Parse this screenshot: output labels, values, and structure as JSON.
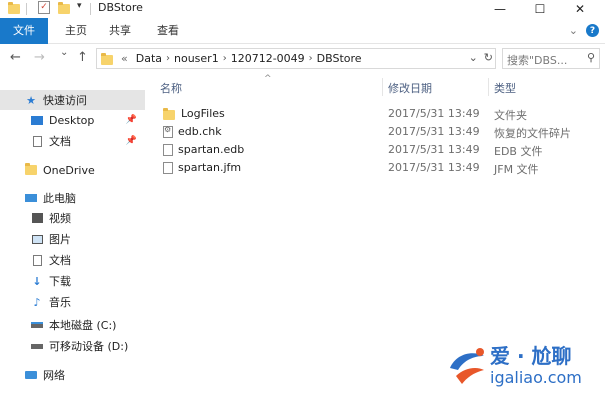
{
  "window": {
    "title": "DBStore",
    "controls": {
      "minimize": "—",
      "maximize": "☐",
      "close": "✕"
    }
  },
  "ribbon": {
    "tabs": [
      "文件",
      "主页",
      "共享",
      "查看"
    ],
    "expand_icon": "chevron-down-icon",
    "help_icon": "help-icon"
  },
  "navigation": {
    "back": "←",
    "forward": "→",
    "recent": "⌄",
    "up": "↑",
    "overflow": "«",
    "path": [
      "Data",
      "nouser1",
      "120712-0049",
      "DBStore"
    ],
    "search_placeholder": "搜索\"DBS...",
    "refresh": "↻",
    "dropdown": "⌄"
  },
  "sidebar": {
    "items": [
      {
        "label": "快速访问",
        "icon": "star-icon",
        "selected": true
      },
      {
        "label": "Desktop",
        "icon": "desktop-icon",
        "pinned": true
      },
      {
        "label": "文档",
        "icon": "document-icon",
        "pinned": true
      },
      {
        "label": "OneDrive",
        "icon": "folder-icon"
      },
      {
        "label": "此电脑",
        "icon": "computer-icon"
      },
      {
        "label": "视频",
        "icon": "video-icon"
      },
      {
        "label": "图片",
        "icon": "picture-icon"
      },
      {
        "label": "文档",
        "icon": "document-icon"
      },
      {
        "label": "下载",
        "icon": "download-icon"
      },
      {
        "label": "音乐",
        "icon": "music-icon"
      },
      {
        "label": "本地磁盘 (C:)",
        "icon": "local-disk-icon"
      },
      {
        "label": "可移动设备 (D:)",
        "icon": "removable-drive-icon"
      },
      {
        "label": "网络",
        "icon": "network-icon"
      }
    ]
  },
  "columns": {
    "name": "名称",
    "date": "修改日期",
    "type": "类型"
  },
  "files": [
    {
      "name": "LogFiles",
      "date": "2017/5/31 13:49",
      "type": "文件夹",
      "icon": "folder-icon"
    },
    {
      "name": "edb.chk",
      "date": "2017/5/31 13:49",
      "type": "恢复的文件碎片",
      "icon": "settings-file-icon"
    },
    {
      "name": "spartan.edb",
      "date": "2017/5/31 13:49",
      "type": "EDB 文件",
      "icon": "file-icon"
    },
    {
      "name": "spartan.jfm",
      "date": "2017/5/31 13:49",
      "type": "JFM 文件",
      "icon": "file-icon"
    }
  ],
  "watermark": {
    "line1": "爱 · 尬聊",
    "line2": "igaliao.com"
  },
  "colors": {
    "accent": "#1979ca",
    "selection": "#e5e5e5",
    "watermark": "#2d6fc6"
  }
}
